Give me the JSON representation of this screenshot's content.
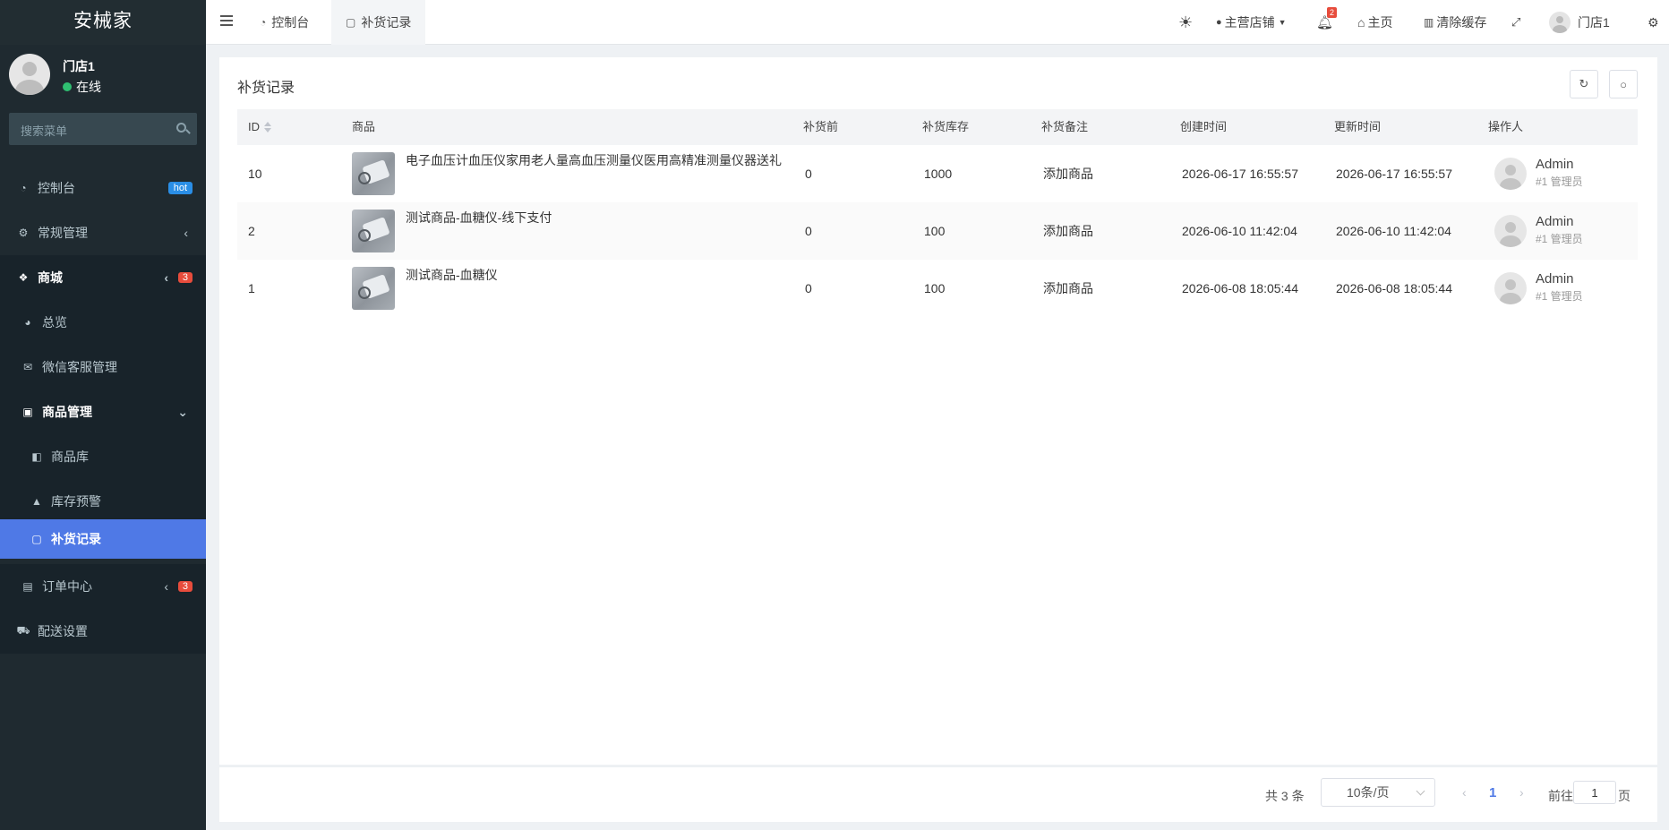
{
  "app": {
    "brand": "安械家"
  },
  "user": {
    "name": "门店1",
    "status": "在线"
  },
  "sidebar": {
    "search_placeholder": "搜索菜单",
    "items": [
      {
        "label": "控制台",
        "icon": "dashboard-icon",
        "badge": "hot"
      },
      {
        "label": "常规管理",
        "icon": "cogs-icon"
      },
      {
        "label": "商城",
        "icon": "dropbox-icon",
        "badge": "3"
      },
      {
        "label": "总览",
        "icon": "pie-chart-icon"
      },
      {
        "label": "微信客服管理",
        "icon": "comments-icon"
      },
      {
        "label": "商品管理",
        "icon": "archive-icon"
      },
      {
        "label": "商品库",
        "icon": "shopping-bag-icon"
      },
      {
        "label": "库存预警",
        "icon": "warning-icon"
      },
      {
        "label": "补货记录",
        "icon": "sticky-note-icon"
      },
      {
        "label": "订单中心",
        "icon": "file-icon",
        "badge": "3"
      },
      {
        "label": "配送设置",
        "icon": "car-icon"
      }
    ]
  },
  "topbar": {
    "tabs": [
      {
        "label": "控制台",
        "icon": "dashboard-icon"
      },
      {
        "label": "补货记录",
        "icon": "sticky-note-icon"
      }
    ],
    "store_label": "主营店铺",
    "notification_count": "2",
    "home_label": "主页",
    "clear_cache_label": "清除缓存",
    "user_name": "门店1"
  },
  "page": {
    "title": "补货记录"
  },
  "table": {
    "columns": [
      "ID",
      "商品",
      "补货前",
      "补货库存",
      "补货备注",
      "创建时间",
      "更新时间",
      "操作人"
    ],
    "rows": [
      {
        "id": "10",
        "product": "电子血压计血压仪家用老人量高血压测量仪医用高精准测量仪器送礼",
        "before": "0",
        "stock": "1000",
        "note": "添加商品",
        "created": "2026-06-17 16:55:57",
        "updated": "2026-06-17 16:55:57",
        "operator": "Admin",
        "role": "#1 管理员"
      },
      {
        "id": "2",
        "product": "测试商品-血糖仪-线下支付",
        "before": "0",
        "stock": "100",
        "note": "添加商品",
        "created": "2026-06-10 11:42:04",
        "updated": "2026-06-10 11:42:04",
        "operator": "Admin",
        "role": "#1 管理员"
      },
      {
        "id": "1",
        "product": "测试商品-血糖仪",
        "before": "0",
        "stock": "100",
        "note": "添加商品",
        "created": "2026-06-08 18:05:44",
        "updated": "2026-06-08 18:05:44",
        "operator": "Admin",
        "role": "#1 管理员"
      }
    ]
  },
  "pagination": {
    "total_text": "共 3 条",
    "page_size": "10条/页",
    "current_page": "1",
    "goto_label": "前往",
    "goto_value": "1",
    "page_suffix": "页"
  },
  "colors": {
    "sidebar_bg": "#1f2a30",
    "active": "#4f79e6",
    "badge_red": "#e74c3c",
    "badge_hot": "#2a8ee6"
  }
}
